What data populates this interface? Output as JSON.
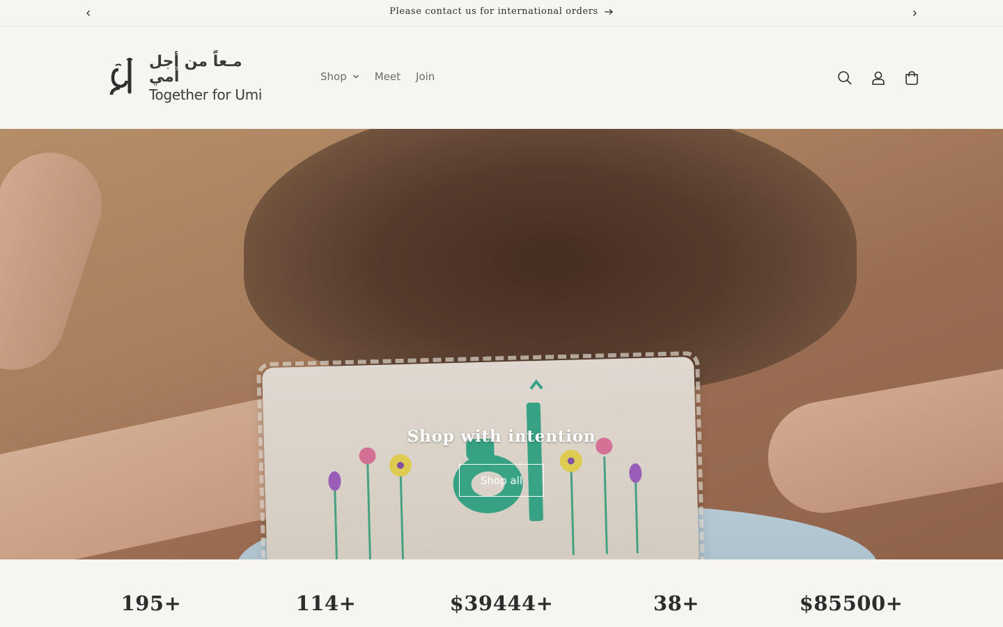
{
  "announcement": {
    "message": "Please contact us for international orders",
    "prev_icon": "chevron-left-icon",
    "next_icon": "chevron-right-icon",
    "link_icon": "arrow-right-icon"
  },
  "header": {
    "logo": {
      "arabic": "مـعاً من أجل أمي",
      "english": "Together for Umi",
      "mark_text": "أُمّي"
    },
    "nav": [
      {
        "label": "Shop",
        "has_dropdown": true
      },
      {
        "label": "Meet"
      },
      {
        "label": "Join"
      }
    ],
    "icons": [
      "search-icon",
      "account-icon",
      "cart-icon"
    ]
  },
  "hero": {
    "heading": "Shop with intention",
    "button": "Shop all",
    "embroidery_text": "أُمّي"
  },
  "stats": [
    "195+",
    "114+",
    "$39444+",
    "38+",
    "$85500+"
  ],
  "colors": {
    "background": "#f7f5f2",
    "text": "#2b2b2b",
    "nav_text": "#6b6b6b",
    "embroidery_green": "#3bb08f"
  }
}
